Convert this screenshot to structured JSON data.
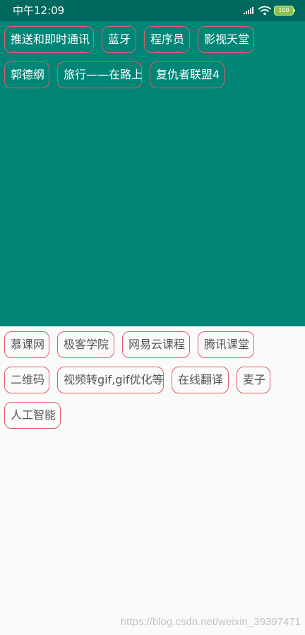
{
  "status_bar": {
    "time": "中午12:09",
    "battery": "100",
    "signal_icon": "signal-icon",
    "wifi_icon": "wifi-icon",
    "battery_icon": "battery-icon"
  },
  "top_tags": {
    "items": [
      "推送和即时通讯",
      "蓝牙",
      "程序员",
      "影视天堂",
      "郭德纲",
      "旅行——在路上",
      "复仇者联盟4"
    ]
  },
  "bottom_tags": {
    "items": [
      "慕课网",
      "极客学院",
      "网易云课程",
      "腾讯课堂",
      "二维码",
      "视频转gif,gif优化等",
      "在线翻译",
      "麦子",
      "人工智能"
    ]
  },
  "watermark": "https://blog.csdn.net/weixin_39397471",
  "colors": {
    "status_bar_bg": "#00695f",
    "top_panel_bg": "#008577",
    "tag_border": "#e25b66",
    "bottom_panel_bg": "#fafafa"
  }
}
